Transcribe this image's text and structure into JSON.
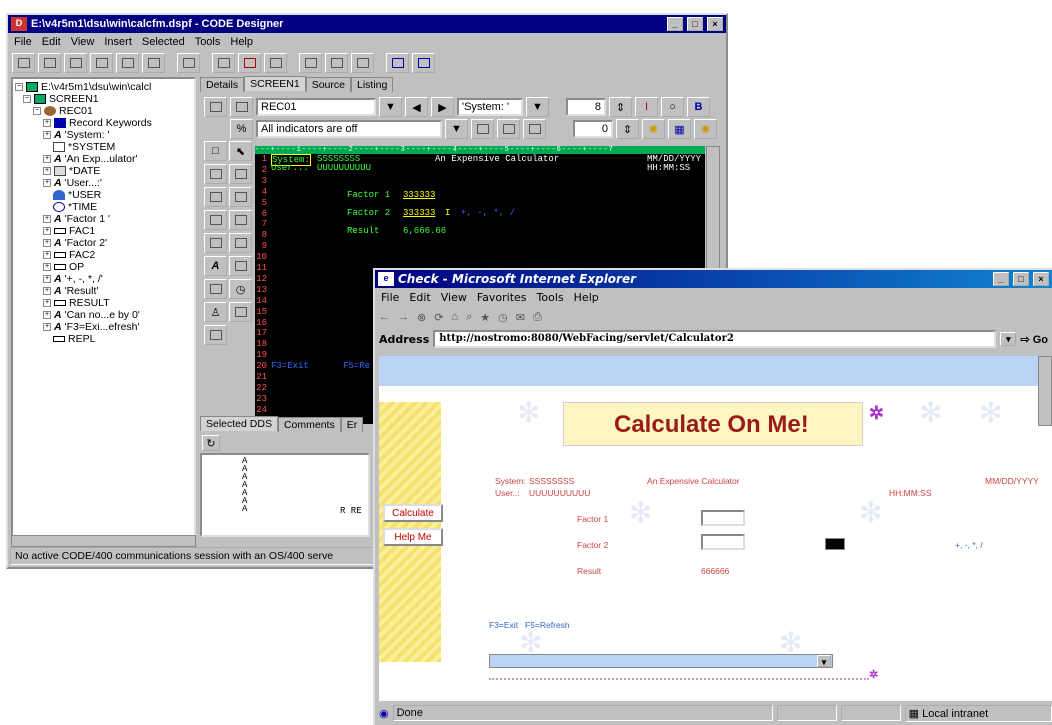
{
  "designer": {
    "title": "E:\\v4r5m1\\dsu\\win\\calcfm.dspf - CODE Designer",
    "menu": [
      "File",
      "Edit",
      "View",
      "Insert",
      "Selected",
      "Tools",
      "Help"
    ],
    "tree_root": "E:\\v4r5m1\\dsu\\win\\calcl",
    "tree": [
      "SCREEN1",
      "REC01",
      "Record Keywords",
      "'System: '",
      "*SYSTEM",
      "'An Exp...ulator'",
      "*DATE",
      "'User...:'",
      "*USER",
      "*TIME",
      "'Factor 1 '",
      "FAC1",
      "'Factor 2'",
      "FAC2",
      "OP",
      "'+, -, *, /'",
      "'Result'",
      "RESULT",
      "'Can no...e by 0'",
      "'F3=Exi...efresh'",
      "REPL"
    ],
    "tabs": [
      "Details",
      "SCREEN1",
      "Source",
      "Listing"
    ],
    "record_combo": "REC01",
    "field_combo": "'System: '",
    "spin_value": "8",
    "spin_value2": "0",
    "indicator_combo": "All indicators are off",
    "screen_lines": {
      "l1a": "System:",
      "l1b": "SSSSSSSS",
      "l1c": "An Expensive Calculator",
      "l1d": "MM/DD/YYYY",
      "l2a": "User..:",
      "l2b": "UUUUUUUUUU",
      "l2d": "HH:MM:SS",
      "f1": "Factor 1",
      "f1v": "333333",
      "f2": "Factor 2",
      "f2v": "333333",
      "f2o": "+, -, *, /",
      "res": "Result",
      "resv": "6,666.66",
      "f3": "F3=Exit",
      "f5": "F5=Re"
    },
    "line_numbers": [
      "1",
      "2",
      "3",
      "4",
      "5",
      "6",
      "7",
      "8",
      "9",
      "10",
      "11",
      "12",
      "13",
      "14",
      "15",
      "16",
      "17",
      "18",
      "19",
      "20",
      "21",
      "22",
      "23",
      "24"
    ],
    "bottom_tabs": [
      "Selected DDS",
      "Comments",
      "Er"
    ],
    "dds_lines": [
      "A",
      "A",
      "A",
      "A",
      "A",
      "A",
      "A"
    ],
    "dds_rec": "R RE",
    "status": "No active CODE/400 communications session with an OS/400 serve"
  },
  "browser": {
    "title": "Check - Microsoft Internet Explorer",
    "menu": [
      "File",
      "Edit",
      "View",
      "Favorites",
      "Tools",
      "Help"
    ],
    "address_label": "Address",
    "url": "http://nostromo:8080/WebFacing/servlet/Calculator2",
    "go": "Go",
    "banner": "Calculate On Me!",
    "buttons": [
      "Calculate",
      "Help Me"
    ],
    "system_label": "System:",
    "system_val": "SSSSSSSS",
    "heading": "An Expensive Calculator",
    "date": "MM/DD/YYYY",
    "user_label": "User..:",
    "user_val": "UUUUUUUUUU",
    "time": "HH:MM:SS",
    "factor1": "Factor 1",
    "factor2": "Factor 2",
    "ops": "+, -, *, /",
    "result_label": "Result",
    "result_val": "666666",
    "f3": "F3=Exit",
    "f5": "F5=Refresh",
    "status_done": "Done",
    "status_zone": "Local intranet"
  }
}
